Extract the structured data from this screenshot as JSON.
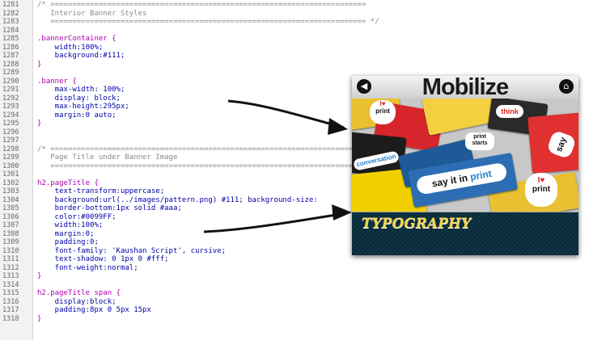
{
  "editor": {
    "lines": [
      {
        "num": "1281",
        "text": "/* ========================================================================"
      },
      {
        "num": "1282",
        "text": "   Interior Banner Styles"
      },
      {
        "num": "1283",
        "text": "   ======================================================================== */"
      },
      {
        "num": "1284",
        "text": ""
      },
      {
        "num": "1285",
        "text": ".bannerContainer {"
      },
      {
        "num": "1286",
        "text": "    width:100%;"
      },
      {
        "num": "1287",
        "text": "    background:#111;"
      },
      {
        "num": "1288",
        "text": "}"
      },
      {
        "num": "1289",
        "text": ""
      },
      {
        "num": "1290",
        "text": ".banner {"
      },
      {
        "num": "1291",
        "text": "    max-width: 100%;"
      },
      {
        "num": "1292",
        "text": "    display: block;"
      },
      {
        "num": "1293",
        "text": "    max-height:295px;"
      },
      {
        "num": "1294",
        "text": "    margin:0 auto;"
      },
      {
        "num": "1295",
        "text": "}"
      },
      {
        "num": "1296",
        "text": ""
      },
      {
        "num": "1297",
        "text": ""
      },
      {
        "num": "1298",
        "text": "/* ========================================================================"
      },
      {
        "num": "1299",
        "text": "   Page Title under Banner Image"
      },
      {
        "num": "1300",
        "text": "   ========================================================================"
      },
      {
        "num": "1301",
        "text": ""
      },
      {
        "num": "1302",
        "text": "h2.pageTitle {"
      },
      {
        "num": "1303",
        "text": "    text-transform:uppercase;"
      },
      {
        "num": "1304",
        "text": "    background:url(../images/pattern.png) #111; background-size:"
      },
      {
        "num": "1305",
        "text": "    border-bottom:1px solid #aaa;"
      },
      {
        "num": "1306",
        "text": "    color:#0099FF;"
      },
      {
        "num": "1307",
        "text": "    width:100%;"
      },
      {
        "num": "1308",
        "text": "    margin:0;"
      },
      {
        "num": "1309",
        "text": "    padding:0;"
      },
      {
        "num": "1310",
        "text": "    font-family: 'Kaushan Script', cursive;"
      },
      {
        "num": "1311",
        "text": "    text-shadow: 0 1px 0 #fff;"
      },
      {
        "num": "1312",
        "text": "    font-weight:normal;"
      },
      {
        "num": "1313",
        "text": "}"
      },
      {
        "num": "1314",
        "text": ""
      },
      {
        "num": "1315",
        "text": "h2.pageTitle span {"
      },
      {
        "num": "1316",
        "text": "    display:block;"
      },
      {
        "num": "1317",
        "text": "    padding:8px 0 5px 15px"
      },
      {
        "num": "1318",
        "text": "}"
      }
    ]
  },
  "phone": {
    "header_title": "Mobilize",
    "back_icon": "back-arrow-icon",
    "home_icon": "home-icon",
    "banner_texts": {
      "say_it": "say it in",
      "say_it_accent": "print",
      "love_print_i": "I",
      "love_print": "print",
      "print_starts": "print starts",
      "conversation": "conversation",
      "think": "think",
      "say": "say"
    },
    "page_title": "Typography"
  },
  "colors": {
    "comment": "#8a8a8a",
    "selector": "#b000b0",
    "property": "#0000aa",
    "title_yellow": "#f2d34a",
    "banner_bg": "#0a2936"
  }
}
